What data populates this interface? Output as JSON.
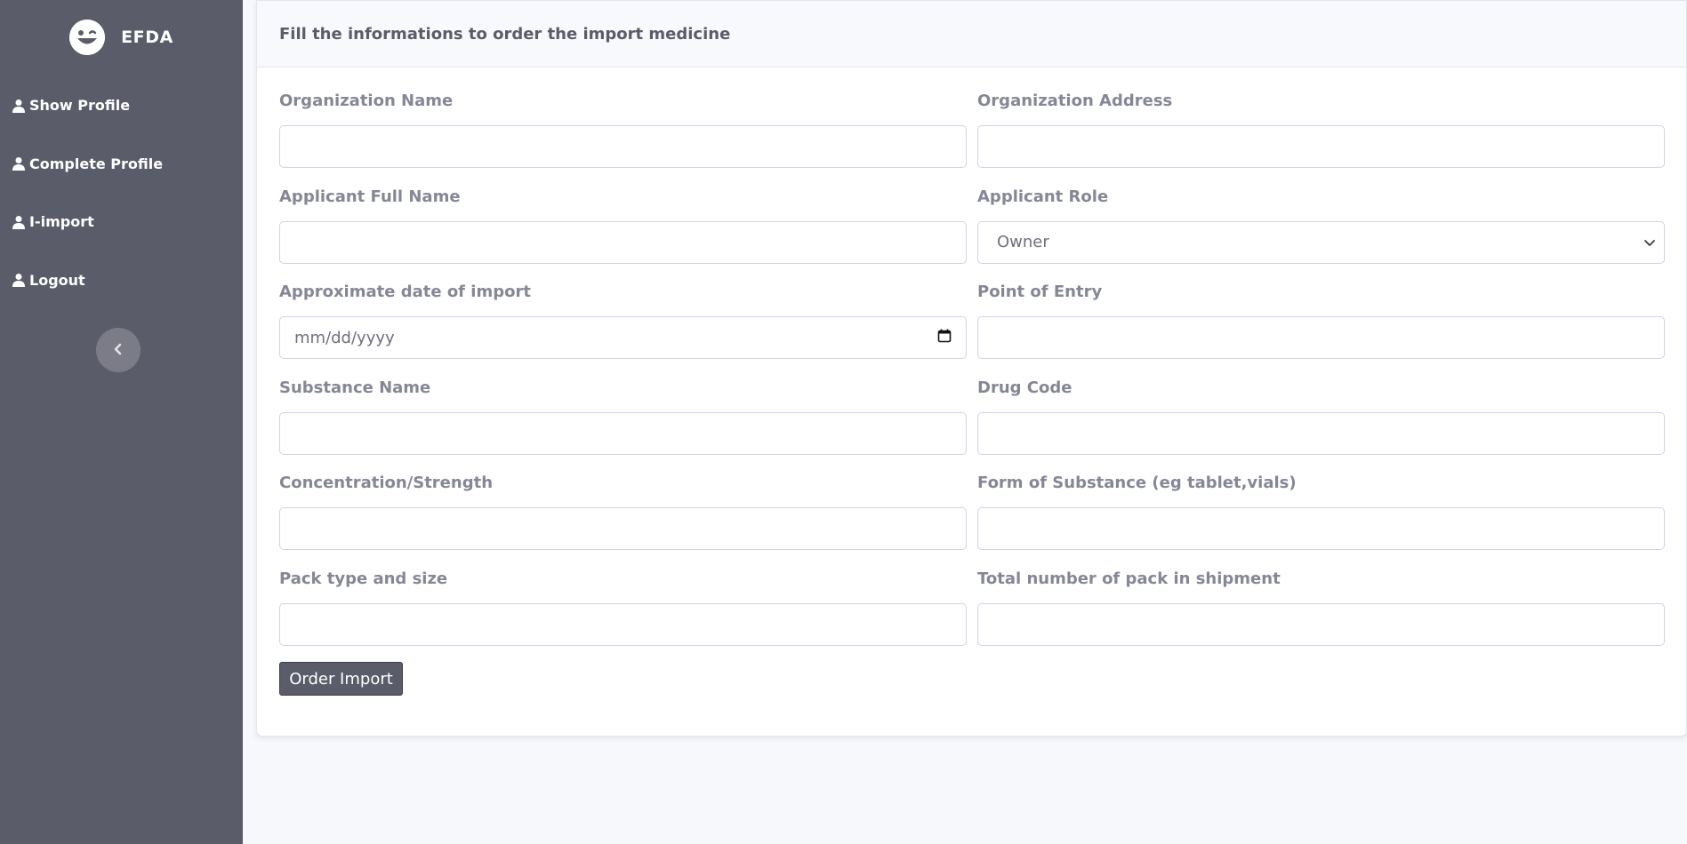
{
  "brand": {
    "name": "EFDA",
    "logo_icon": "laugh-wink-icon"
  },
  "sidebar": {
    "items": [
      {
        "label": "Show Profile",
        "icon": "user-icon"
      },
      {
        "label": "Complete Profile",
        "icon": "user-icon"
      },
      {
        "label": "I-import",
        "icon": "user-icon"
      },
      {
        "label": "Logout",
        "icon": "user-icon"
      }
    ],
    "toggle_icon": "chevron-left-icon"
  },
  "card": {
    "header": "Fill the informations to order the import medicine"
  },
  "form": {
    "organization_name": {
      "label": "Organization Name",
      "value": ""
    },
    "organization_address": {
      "label": "Organization Address",
      "value": ""
    },
    "applicant_full_name": {
      "label": "Applicant Full Name",
      "value": ""
    },
    "applicant_role": {
      "label": "Applicant Role",
      "value": "Owner"
    },
    "import_date": {
      "label": "Approximate date of import",
      "placeholder": "mm/dd/yyyy"
    },
    "point_of_entry": {
      "label": "Point of Entry",
      "value": ""
    },
    "substance_name": {
      "label": "Substance Name",
      "value": ""
    },
    "drug_code": {
      "label": "Drug Code",
      "value": ""
    },
    "concentration": {
      "label": "Concentration/Strength",
      "value": ""
    },
    "form_of_substance": {
      "label": "Form of Substance (eg tablet,vials)",
      "value": ""
    },
    "pack_type_size": {
      "label": "Pack type and size",
      "value": ""
    },
    "total_packs": {
      "label": "Total number of pack in shipment",
      "value": ""
    },
    "submit_label": "Order Import"
  },
  "colors": {
    "sidebar_bg": "#5a5c69",
    "page_bg": "#f7f8fc",
    "label_text": "#858796",
    "button_bg": "#5a5c69"
  }
}
